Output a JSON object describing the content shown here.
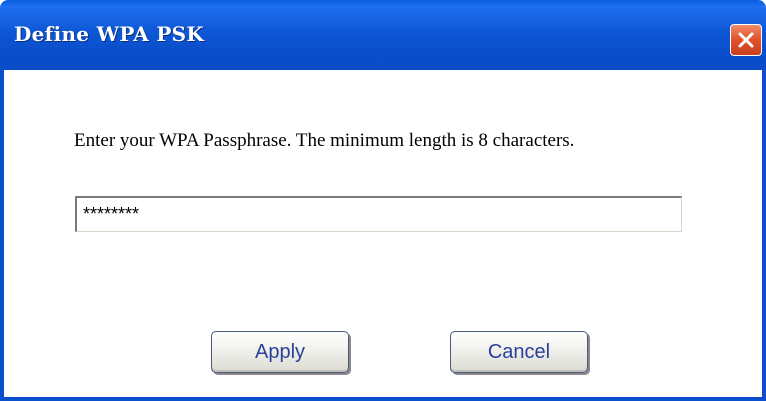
{
  "window": {
    "title": "Define WPA PSK"
  },
  "dialog": {
    "prompt": "Enter your WPA Passphrase.  The minimum length is 8 characters.",
    "passphrase_value": "********",
    "apply_label": "Apply",
    "cancel_label": "Cancel"
  },
  "icons": {
    "close": "close-icon"
  },
  "colors": {
    "titlebar": "#0b4fcc",
    "close_button": "#e0502a",
    "button_text": "#2a3f9a"
  }
}
